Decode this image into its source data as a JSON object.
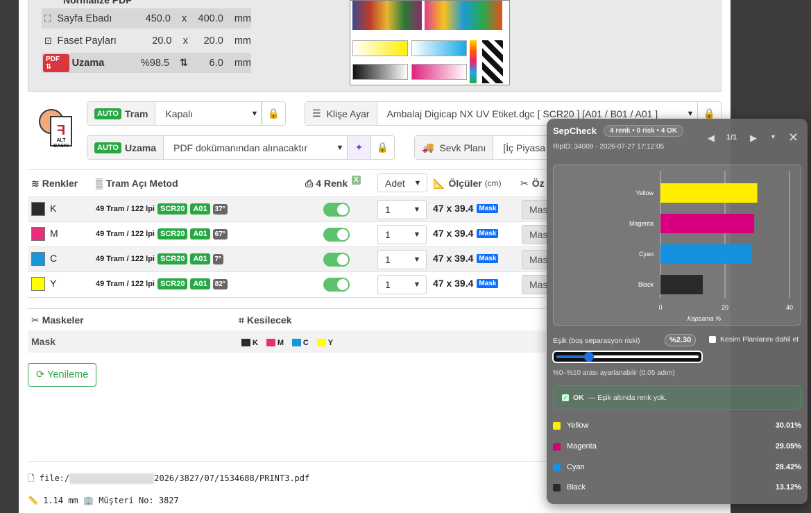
{
  "dims": {
    "partial_header": "Normalize PDF",
    "rows": [
      {
        "icon": "page-size-icon",
        "label": "Sayfa Ebadı",
        "v1": "450.0",
        "sep": "x",
        "v2": "400.0",
        "unit": "mm"
      },
      {
        "icon": "bleed-icon",
        "label": "Faset Payları",
        "v1": "20.0",
        "sep": "x",
        "v2": "20.0",
        "unit": "mm"
      },
      {
        "badge": "PDF ⇅",
        "label": "Uzama",
        "v1": "%98.5",
        "sep": "⇅",
        "v2": "6.0",
        "unit": "mm"
      }
    ]
  },
  "logo_text": "ALT BASKI",
  "controls": {
    "tram": {
      "auto": "AUTO",
      "label": "Tram",
      "value": "Kapalı"
    },
    "uzama": {
      "auto": "AUTO",
      "label": "Uzama",
      "value": "PDF dokümanından alınacaktır"
    },
    "klise": {
      "label": "Klişe Ayar",
      "value": "Ambalaj Digicap NX UV Etiket.dgc [ SCR20 ] [A01 / B01 / A01 ]"
    },
    "sevk": {
      "label": "Sevk Planı",
      "value": "[İç Piyasa"
    }
  },
  "table": {
    "headers": {
      "renkler": "Renkler",
      "tram_metod": "Tram Açı Metod",
      "renk": "4 Renk",
      "adet": "Adet",
      "olculer": "Ölçüler",
      "olculer_unit": "(cm)",
      "oz": "Öz"
    },
    "rows": [
      {
        "name": "K",
        "color": "#2b2b2b",
        "tram": "49 Tram / 122 lpi",
        "scr": "SCR20",
        "a": "A01",
        "deg": "37°",
        "qty": "1",
        "dims": "47 x 39.4",
        "mask": "Mask",
        "btn": "Mas"
      },
      {
        "name": "M",
        "color": "#e5307a",
        "tram": "49 Tram / 122 lpi",
        "scr": "SCR20",
        "a": "A01",
        "deg": "67°",
        "qty": "1",
        "dims": "47 x 39.4",
        "mask": "Mask",
        "btn": "Mas"
      },
      {
        "name": "C",
        "color": "#1a95dd",
        "tram": "49 Tram / 122 lpi",
        "scr": "SCR20",
        "a": "A01",
        "deg": "7°",
        "qty": "1",
        "dims": "47 x 39.4",
        "mask": "Mask",
        "btn": "Mas"
      },
      {
        "name": "Y",
        "color": "#ffff00",
        "tram": "49 Tram / 122 lpi",
        "scr": "SCR20",
        "a": "A01",
        "deg": "82°",
        "qty": "1",
        "dims": "47 x 39.4",
        "mask": "Mask",
        "btn": "Mas"
      }
    ]
  },
  "masks": {
    "header": "Maskeler",
    "kesilecek": "Kesilecek",
    "row_label": "Mask",
    "chips": [
      {
        "name": "K",
        "color": "#2b2b2b"
      },
      {
        "name": "M",
        "color": "#e5307a"
      },
      {
        "name": "C",
        "color": "#1a95dd"
      },
      {
        "name": "Y",
        "color": "#ffff00"
      }
    ]
  },
  "refresh_label": "Yenileme",
  "footer": {
    "file_prefix": "file:/",
    "file_suffix": "2026/3827/07/1534688/PRINT3.pdf",
    "thickness": "1.14 mm",
    "customer": "Müşteri No: 3827"
  },
  "sepcheck": {
    "title": "SepCheck",
    "summary": "4 renk • 0 risk • 4 OK",
    "page": "1/1",
    "rip": "RipID: 34009 - 2026-07-27 17:12:05",
    "threshold_label": "Eşik (boş separasyon riski)",
    "threshold_value": "%2.30",
    "threshold_fraction": 0.23,
    "include_label": "Kesim Planlarını dahil et",
    "hint": "%0–%10 arası ayarlanabilir (0.05 adım)",
    "ok_bold": "OK",
    "ok_text": "— Eşik altında renk yok.",
    "legend": [
      {
        "name": "Yellow",
        "pct": "30.01%",
        "color": "#ffee00"
      },
      {
        "name": "Magenta",
        "pct": "29.05%",
        "color": "#d6007e"
      },
      {
        "name": "Cyan",
        "pct": "28.42%",
        "color": "#1690e0"
      },
      {
        "name": "Black",
        "pct": "13.12%",
        "color": "#2a2a2a"
      }
    ]
  },
  "chart_data": {
    "type": "bar",
    "orientation": "horizontal",
    "categories": [
      "Yellow",
      "Magenta",
      "Cyan",
      "Black"
    ],
    "values": [
      30.01,
      29.05,
      28.42,
      13.12
    ],
    "colors": [
      "#ffee00",
      "#d6007e",
      "#1690e0",
      "#2a2a2a"
    ],
    "xlabel": "Kapsama %",
    "xlim": [
      0,
      40
    ],
    "xticks": [
      "0",
      "20",
      "40"
    ],
    "grid": true
  }
}
